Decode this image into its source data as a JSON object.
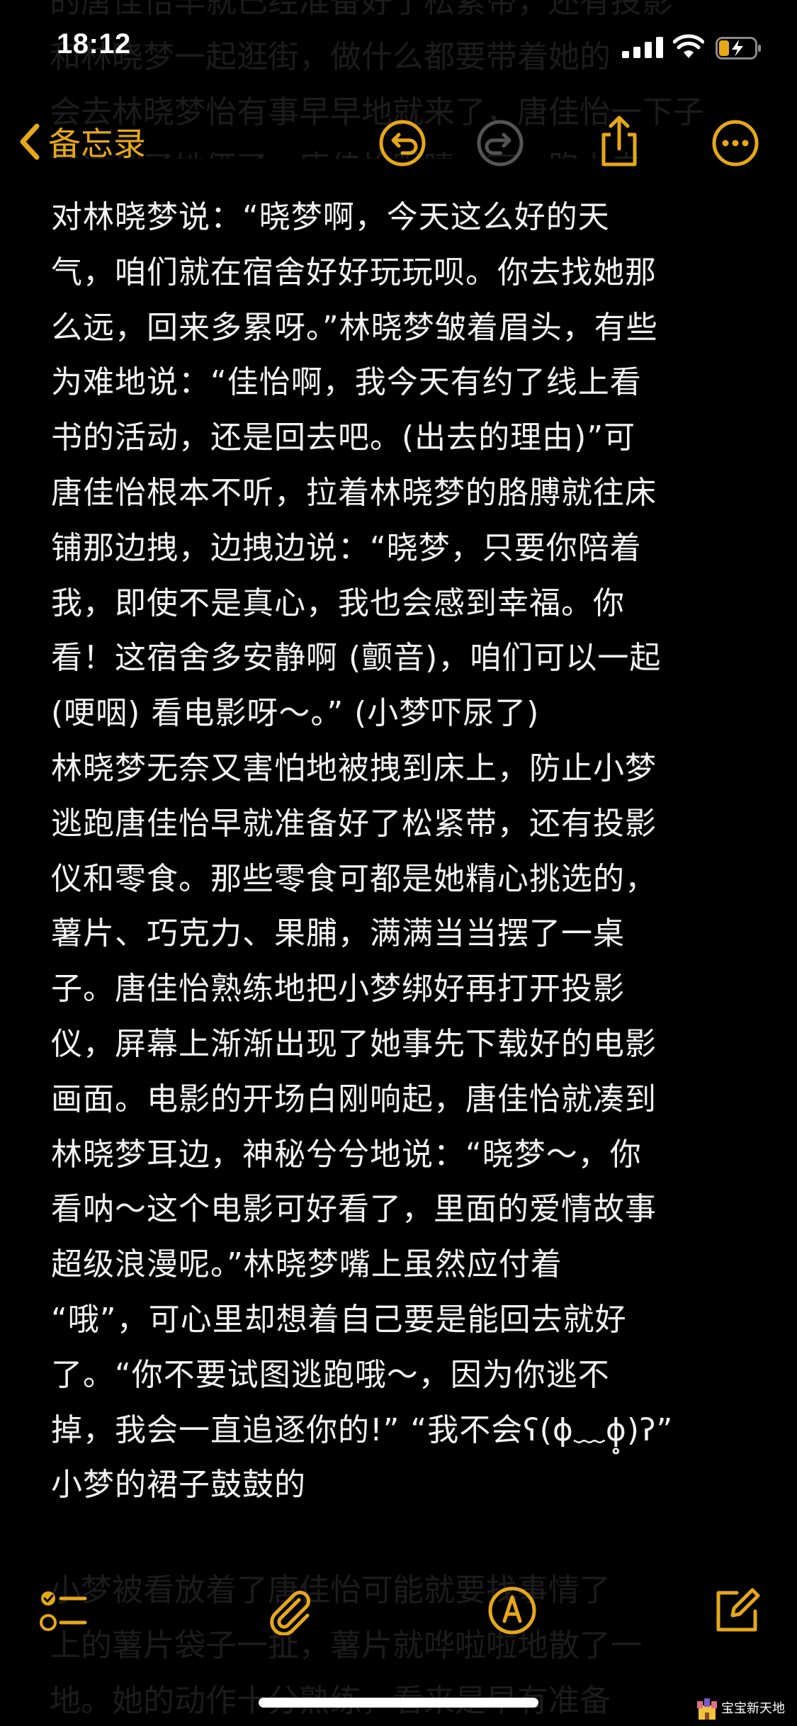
{
  "status_bar": {
    "time": "18:12"
  },
  "nav": {
    "back_label": "备忘录",
    "icons": [
      "undo-icon",
      "redo-icon",
      "share-icon",
      "more-icon"
    ]
  },
  "note": {
    "lines": [
      "对林晓梦说：“晓梦啊，今天这么好的天",
      "气，咱们就在宿舍好好玩玩呗。你去找她那",
      "么远，回来多累呀。”林晓梦皱着眉头，有些",
      "为难地说：“佳怡啊，我今天有约了线上看",
      "书的活动，还是回去吧。(出去的理由)”可",
      "唐佳怡根本不听，拉着林晓梦的胳膊就往床",
      "铺那边拽，边拽边说：“晓梦，只要你陪着",
      "我，即使不是真心，我也会感到幸福。你",
      "看！这宿舍多安静啊 (颤音)，咱们可以一起",
      "(哽咽) 看电影呀～。” (小梦吓尿了)",
      "林晓梦无奈又害怕地被拽到床上，防止小梦",
      "逃跑唐佳怡早就准备好了松紧带，还有投影",
      "仪和零食。那些零食可都是她精心挑选的，",
      "薯片、巧克力、果脯，满满当当摆了一桌",
      "子。唐佳怡熟练地把小梦绑好再打开投影",
      "仪，屏幕上渐渐出现了她事先下载好的电影",
      "画面。电影的开场白刚响起，唐佳怡就凑到",
      "林晓梦耳边，神秘兮兮地说：“晓梦～，你",
      "看呐～这个电影可好看了，里面的爱情故事",
      "超级浪漫呢。”林晓梦嘴上虽然应付着",
      "“哦”，可心里却想着自己要是能回去就好",
      "了。“你不要试图逃跑哦～，因为你逃不",
      "掉，我会一直追逐你的!” “我不会ʕ(ɸ﹏ɸ̥̥)ʔ”",
      "小梦的裙子鼓鼓的"
    ]
  },
  "ghost": {
    "top": "的唐佳怡早就已经准备好了松紧带，还有投影\n和林晓梦一起逛街，做什么都要带着她的\n会去林晓梦怡有事早早地就来了，唐佳怡一下子\n就冲到了她俩了。唐佳怡眼睛一亮，跑上去",
    "bottom": "小梦被看放着了唐佳怡可能就要找事情了\n上的薯片袋子一扯，薯片就哗啦啦地散了一\n地。她的动作十分熟练，看来是早有准备"
  },
  "toolbar": {
    "icons": [
      "checklist-icon",
      "attachment-icon",
      "markup-icon",
      "compose-icon"
    ]
  },
  "watermark": {
    "text": "宝宝新天地"
  },
  "colors": {
    "accent": "#e6a817",
    "background": "#000000",
    "text": "#f2f2f2",
    "disabled": "#555555"
  }
}
